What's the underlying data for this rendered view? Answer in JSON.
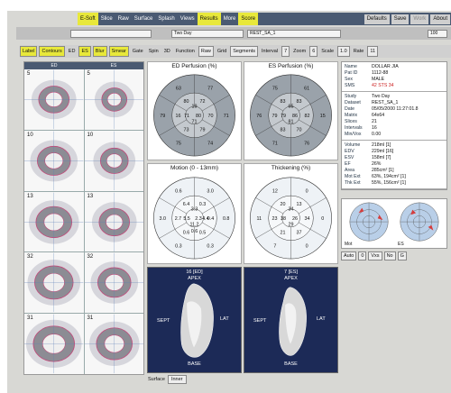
{
  "menu": {
    "items": [
      "E-Soft",
      "Slice",
      "Raw",
      "Surface",
      "Splash",
      "Views",
      "Results",
      "More",
      "Score"
    ],
    "right_buttons": [
      "Defaults",
      "Save",
      "Work",
      "About"
    ]
  },
  "bar2": {
    "study_field": "Two Day",
    "dataset_field": "REST_SA_1",
    "corner": "100"
  },
  "toolbar": {
    "label": "Label",
    "contours": "Contours",
    "ed": "ED",
    "es": "ES",
    "blur": "Blur",
    "smear": "Smear",
    "gate": "Gate",
    "spin": "Spin",
    "threed": "3D",
    "function_label": "Function",
    "function_value": "Raw",
    "grid_label": "Grid",
    "grid_value": "Segments",
    "interval_label": "Interval",
    "interval_value": "7",
    "zoom_label": "Zoom",
    "zoom_value": "6",
    "scale_label": "Scale",
    "scale_value": "1.0",
    "rate_label": "Rate",
    "rate_value": "11"
  },
  "slices": {
    "headers": [
      "ED",
      "ES"
    ],
    "numbers": [
      "5",
      "5",
      "10",
      "10",
      "13",
      "13",
      "32",
      "32",
      "31",
      "31"
    ]
  },
  "polar": {
    "ed_title": "ED Perfusion (%)",
    "es_title": "ES Perfusion (%)",
    "motion_title": "Motion (0 - 13mm)",
    "thick_title": "Thickening (%)",
    "ed_values": [
      "77",
      "71",
      "74",
      "75",
      "79",
      "63",
      "72",
      "70",
      "79",
      "73",
      "16",
      "80",
      "80",
      "71",
      "71",
      "19"
    ],
    "es_values": [
      "61",
      "15",
      "76",
      "71",
      "76",
      "75",
      "83",
      "82",
      "70",
      "83",
      "79",
      "83",
      "86",
      "81",
      "79",
      "65"
    ],
    "motion_values": [
      "3.0",
      "0.8",
      "0.3",
      "0.3",
      "3.0",
      "0.6",
      "0.3",
      "0.4",
      "0.5",
      "0.6",
      "2.7",
      "6.4",
      "2.3",
      "11.2",
      "5.5",
      "3.3",
      "4.4",
      "0.6"
    ],
    "thick_values": [
      "0",
      "0",
      "0",
      "7",
      "11",
      "12",
      "13",
      "34",
      "37",
      "21",
      "23",
      "20",
      "26",
      "29",
      "38",
      "34"
    ]
  },
  "surface": {
    "ed_title": "16 [ED]",
    "es_title": "7 [ES]",
    "apex": "APEX",
    "sept": "SEPT",
    "lat": "LAT",
    "base": "BASE",
    "bar_label": "Surface",
    "bar_value": "Inner"
  },
  "info": {
    "patient": [
      [
        "Name",
        "DOLLAR JIA"
      ],
      [
        "Pat ID",
        "1112-88"
      ],
      [
        "Sex",
        "MALE"
      ],
      [
        "SMS",
        "42   STS   34"
      ]
    ],
    "study": [
      [
        "Study",
        "Two Day"
      ],
      [
        "Dataset",
        "REST_SA_1"
      ],
      [
        "Date",
        "05/05/2000 11:27:01.8"
      ],
      [
        "Matrix",
        "64x64"
      ],
      [
        "Slices",
        "21"
      ],
      [
        "Intervals",
        "16"
      ],
      [
        "Min/Vox",
        "0.00"
      ]
    ],
    "results": [
      [
        "Volume",
        "218ml [1]"
      ],
      [
        "EDV",
        "229ml [16]"
      ],
      [
        "ESV",
        "158ml [7]"
      ],
      [
        "EF",
        "26%"
      ],
      [
        "Area",
        "285cm² [1]"
      ],
      [
        "Mot Ext",
        "63%, 194cm² [1]"
      ],
      [
        "Thk Ext",
        "55%, 156cm² [1]"
      ]
    ]
  },
  "mini": {
    "left": "Mot",
    "right": "ES"
  },
  "controls": {
    "auto": "Auto",
    "v1": "0",
    "vxs": "Vxs",
    "no": "No",
    "g": "G"
  }
}
